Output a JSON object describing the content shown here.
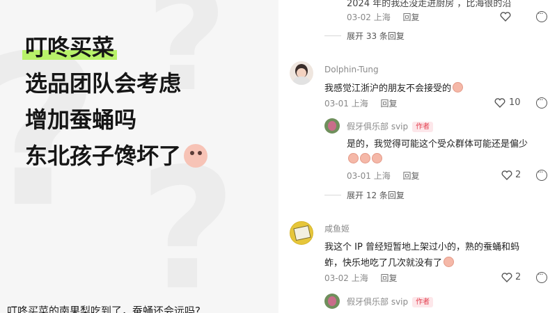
{
  "post": {
    "title_lines": [
      "叮咚买菜",
      "选品团队会考虑",
      "增加蚕蛹吗",
      "东北孩子馋坏了"
    ],
    "emoji": "pleading-face-sticker",
    "caption": "叮咚买菜的南果梨吃到了，蚕蛹还会远吗?"
  },
  "comments": {
    "top_partial": {
      "text": "2024 年的我还没走进厨房 ，比海很的沿",
      "date": "03-02",
      "location": "上海",
      "reply": "回复"
    },
    "expand_1": "展开 33 条回复",
    "c1": {
      "user": "Dolphin-Tung",
      "text": "我感觉江浙沪的朋友不会接受的",
      "date": "03-01",
      "location": "上海",
      "reply": "回复",
      "likes": "10"
    },
    "r1": {
      "user": "假牙俱乐部 svip",
      "badge": "作者",
      "text": "是的，我觉得可能这个受众群体可能还是偏少",
      "date": "03-01",
      "location": "上海",
      "reply": "回复",
      "likes": "2"
    },
    "expand_2": "展开 12 条回复",
    "c2": {
      "user": "咸鱼姬",
      "text_line1": "我这个 IP 曾经短暂地上架过小的，熟的蚕蛹和蚂",
      "text_line2": "蚱，快乐地吃了几次就没有了",
      "date": "03-02",
      "location": "上海",
      "reply": "回复",
      "likes": "2"
    },
    "r2": {
      "user": "假牙俱乐部 svip",
      "badge": "作者"
    }
  },
  "colors": {
    "highlight": "#b8f26a",
    "badge_text": "#e3404f",
    "badge_bg": "#fde7ea"
  }
}
